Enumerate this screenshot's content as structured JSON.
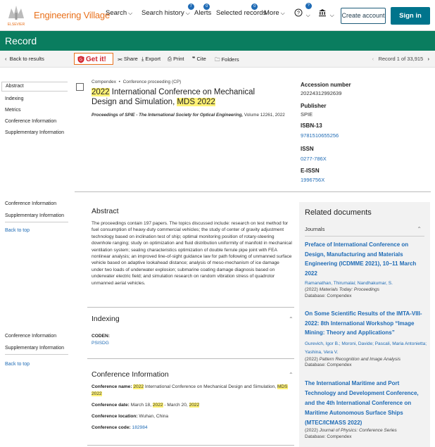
{
  "header": {
    "brand": "Engineering Village",
    "logo_text": "ELSEVIER",
    "nav": {
      "search": "Search",
      "search_history": "Search history",
      "search_history_badge": "7",
      "alerts": "Alerts",
      "alerts_badge": "0",
      "selected_records": "Selected records",
      "selected_records_badge": "0",
      "more": "More",
      "help_badge": "?"
    },
    "create_account": "Create account",
    "sign_in": "Sign in"
  },
  "banner": {
    "title": "Record"
  },
  "toolbar": {
    "back": "Back to results",
    "get_it": "Get it!",
    "share": "Share",
    "export": "Export",
    "print": "Print",
    "cite": "Cite",
    "folders": "Folders",
    "record_position": "Record 1 of 33,915"
  },
  "sidebar": {
    "top": [
      "Abstract",
      "Indexing",
      "Metrics",
      "Conference Information",
      "Supplementary Information"
    ],
    "mid": [
      "Conference Information",
      "Supplementary Information"
    ],
    "bottom": [
      "Conference Information",
      "Supplementary Information"
    ],
    "back_to_top": "Back to top"
  },
  "record": {
    "database": "Compendex",
    "doc_type": "Conference proceeding (CP)",
    "title_hl1": "2022",
    "title_mid": " International Conference on Mechanical Design and Simulation, ",
    "title_hl2": "MDS 2022",
    "source_name": "Proceedings of SPIE - The International Society for Optical Engineering,",
    "source_rest": " Volume 12261, 2022"
  },
  "details": {
    "accession_label": "Accession number",
    "accession_value": "20224312992639",
    "publisher_label": "Publisher",
    "publisher_value": "SPIE",
    "isbn_label": "ISBN-13",
    "isbn_value": "9781510655256",
    "issn_label": "ISSN",
    "issn_value": "0277-786X",
    "eissn_label": "E-ISSN",
    "eissn_value": "1996756X"
  },
  "abstract": {
    "heading": "Abstract",
    "text": "The proceedings contain 197 papers. The topics discussed include: research on test method for fuel consumption of heavy-duty commercial vehicles; the study of center of gravity adjustment technology based on inclination test of ship; optimal monitoring position of rotary-steering downhole ranging; study on optimization and fluid distribution uniformity of manifold in mechanical ventilation system; sealing characteristics optimization of double ferrule pipe joint with FEA nonlinear analysis; an improved line-of-sight guidance law for path following of unmanned surface vehicle based on adaptive lookahead distance; analysis of meso-mechanism of ice damage under two loads of underwater explosion; submarine coating damage diagnosis based on underwater electric field; and simulation research on random vibration stress of quadrotor unmanned aerial vehicles."
  },
  "indexing": {
    "heading": "Indexing",
    "coden_label": "CODEN:",
    "coden_value": "PSISDG"
  },
  "conference": {
    "heading": "Conference Information",
    "name_label": "Conference name:",
    "name_hl1": "2022",
    "name_mid": " International Conference on Mechanical Design and Simulation, ",
    "name_hl2": "MDS 2022",
    "date_label": "Conference date:",
    "date_part1": " March 18, ",
    "date_hl1": "2022",
    "date_part2": " - March 20, ",
    "date_hl2": "2022",
    "location_label": "Conference location:",
    "location_value": " Wuhan, China",
    "code_label": "Conference code:",
    "code_value": "182984"
  },
  "related": {
    "heading": "Related documents",
    "journals": "Journals",
    "docs": [
      {
        "title": "Preface of International Conference on Design, Manufacturing and Materials Engineering (ICDMME 2021), 10–11 March 2022",
        "authors": "Ramanathan, Thirumalai; Nandhakumar, S.",
        "journal_year": "(2022) ",
        "journal": "Materials Today: Proceedings",
        "database": "Database: Compendex"
      },
      {
        "title": "On Some Scientific Results of the IMTA-VIII-2022: 8th International Workshop “Image Mining: Theory and Applications”",
        "authors": "Gurevich, Igor B.; Moroni, Davide; Pascali, Maria Antonietta; Yashina, Vera V.",
        "journal_year": "(2022) ",
        "journal": "Pattern Recognition and Image Analysis",
        "database": "Database: Compendex"
      },
      {
        "title": "The International Maritime and Port Technology and Development Conference, and the 4th International Conference on Maritime Autonomous Surface Ships (MTEC/ICMASS 2022)",
        "journal_year": "(2022) ",
        "journal": "Journal of Physics: Conference Series",
        "database": "Database: Compendex"
      }
    ]
  }
}
